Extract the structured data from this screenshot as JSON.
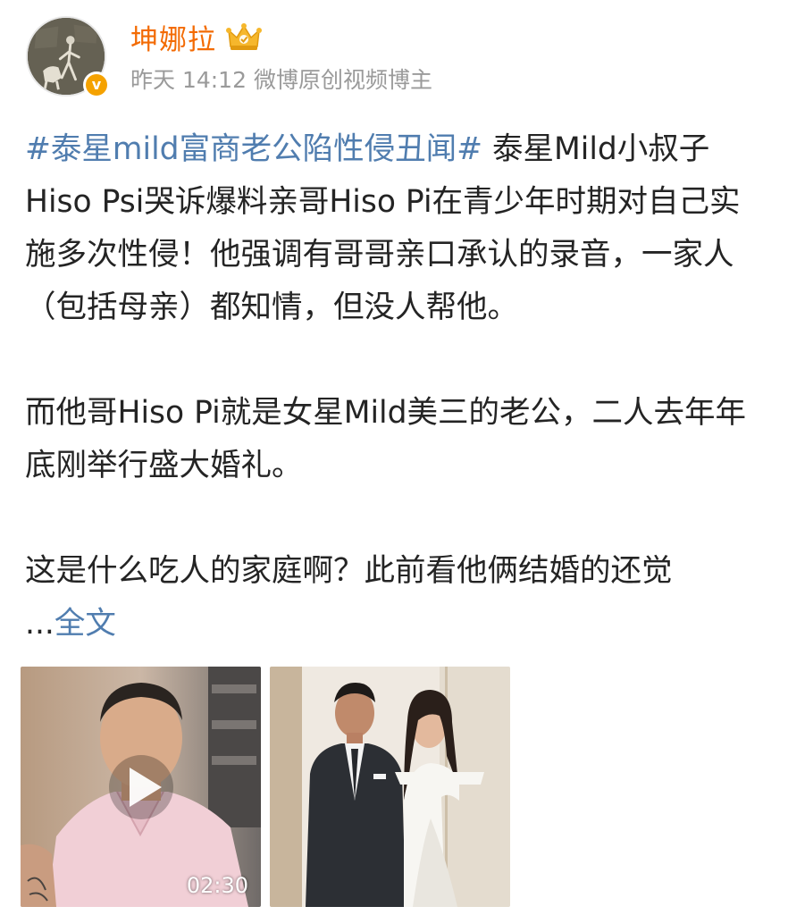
{
  "author": {
    "name": "坤娜拉",
    "avatar_icon": "avatar",
    "verified_icon": "verified-badge-icon",
    "verified_mark": "v",
    "member_icon": "crown-icon",
    "name_color": "#f36b04"
  },
  "meta": {
    "time": "昨天 14:12",
    "source": "微博原创视频博主"
  },
  "post": {
    "hashtag": "#泰星mild富商老公陷性侵丑闻#",
    "para1": " 泰星Mild小叔子 Hiso Psi哭诉爆料亲哥Hiso Pi在青少年时期对自己实施多次性侵！他强调有哥哥亲口承认的录音，一家人（包括母亲）都知情，但没人帮他。",
    "para2": "而他哥Hiso Pi就是女星Mild美三的老公，二人去年年底刚举行盛大婚礼。",
    "para3": "这是什么吃人的家庭啊？此前看他俩结婚的还觉",
    "ellipsis": "...",
    "more_label": "全文",
    "link_color": "#507daf"
  },
  "media": {
    "video": {
      "duration": "02:30",
      "play_icon": "play-icon"
    },
    "photo": {
      "icon": "wedding-photo"
    }
  }
}
